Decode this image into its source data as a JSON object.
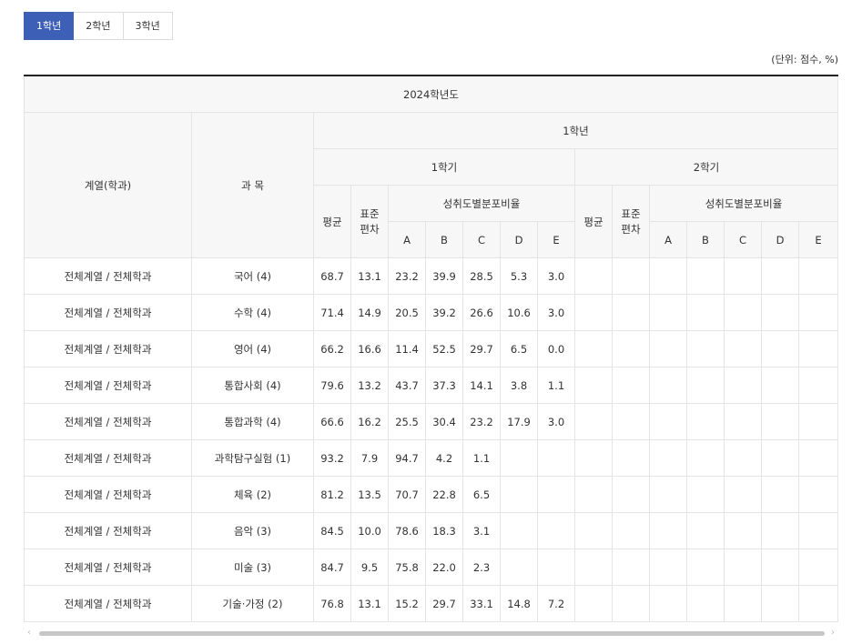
{
  "tabs": [
    {
      "label": "1학년",
      "active": true
    },
    {
      "label": "2학년",
      "active": false
    },
    {
      "label": "3학년",
      "active": false
    }
  ],
  "unit_note": "(단위: 점수, %)",
  "table": {
    "year": "2024학년도",
    "grade": "1학년",
    "col_dept": "계열(학과)",
    "col_subject": "과 목",
    "sem1": "1학기",
    "sem2": "2학기",
    "avg": "평균",
    "std_line1": "표준",
    "std_line2": "편차",
    "dist": "성취도별분포비율",
    "grades": [
      "A",
      "B",
      "C",
      "D",
      "E"
    ],
    "rows": [
      {
        "dept": "전체계열 / 전체학과",
        "subject": "국어 (4)",
        "avg": "68.7",
        "std": "13.1",
        "A": "23.2",
        "B": "39.9",
        "C": "28.5",
        "D": "5.3",
        "E": "3.0"
      },
      {
        "dept": "전체계열 / 전체학과",
        "subject": "수학 (4)",
        "avg": "71.4",
        "std": "14.9",
        "A": "20.5",
        "B": "39.2",
        "C": "26.6",
        "D": "10.6",
        "E": "3.0"
      },
      {
        "dept": "전체계열 / 전체학과",
        "subject": "영어 (4)",
        "avg": "66.2",
        "std": "16.6",
        "A": "11.4",
        "B": "52.5",
        "C": "29.7",
        "D": "6.5",
        "E": "0.0"
      },
      {
        "dept": "전체계열 / 전체학과",
        "subject": "통합사회 (4)",
        "avg": "79.6",
        "std": "13.2",
        "A": "43.7",
        "B": "37.3",
        "C": "14.1",
        "D": "3.8",
        "E": "1.1"
      },
      {
        "dept": "전체계열 / 전체학과",
        "subject": "통합과학 (4)",
        "avg": "66.6",
        "std": "16.2",
        "A": "25.5",
        "B": "30.4",
        "C": "23.2",
        "D": "17.9",
        "E": "3.0"
      },
      {
        "dept": "전체계열 / 전체학과",
        "subject": "과학탐구실험 (1)",
        "avg": "93.2",
        "std": "7.9",
        "A": "94.7",
        "B": "4.2",
        "C": "1.1",
        "D": "",
        "E": ""
      },
      {
        "dept": "전체계열 / 전체학과",
        "subject": "체육 (2)",
        "avg": "81.2",
        "std": "13.5",
        "A": "70.7",
        "B": "22.8",
        "C": "6.5",
        "D": "",
        "E": ""
      },
      {
        "dept": "전체계열 / 전체학과",
        "subject": "음악 (3)",
        "avg": "84.5",
        "std": "10.0",
        "A": "78.6",
        "B": "18.3",
        "C": "3.1",
        "D": "",
        "E": ""
      },
      {
        "dept": "전체계열 / 전체학과",
        "subject": "미술 (3)",
        "avg": "84.7",
        "std": "9.5",
        "A": "75.8",
        "B": "22.0",
        "C": "2.3",
        "D": "",
        "E": ""
      },
      {
        "dept": "전체계열 / 전체학과",
        "subject": "기술·가정 (2)",
        "avg": "76.8",
        "std": "13.1",
        "A": "15.2",
        "B": "29.7",
        "C": "33.1",
        "D": "14.8",
        "E": "7.2"
      }
    ]
  },
  "scroll": {
    "left_arrow": "‹",
    "right_arrow": "›"
  }
}
